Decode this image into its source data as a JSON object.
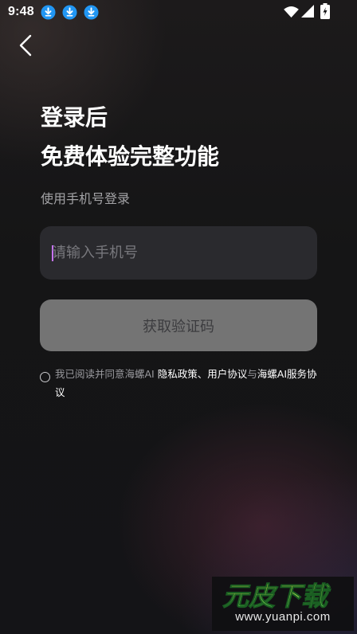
{
  "status_bar": {
    "time": "9:48",
    "notification_icons": [
      "download-icon",
      "download-icon",
      "download-icon"
    ],
    "right_icons": [
      "wifi-icon",
      "signal-icon",
      "battery-charging-icon"
    ]
  },
  "header": {
    "back_icon": "chevron-left-icon"
  },
  "title": {
    "line1": "登录后",
    "line2": "免费体验完整功能"
  },
  "subtitle": "使用手机号登录",
  "phone_field": {
    "value": "",
    "placeholder": "请输入手机号"
  },
  "get_code_button": {
    "label": "获取验证码",
    "state": "disabled"
  },
  "agreement": {
    "checked": false,
    "prefix": "我已阅读并同意海螺AI ",
    "privacy_link": "隐私政策",
    "separator": "、",
    "user_agreement_link": "用户协议",
    "conjunction": "与",
    "service_link": "海螺AI服务协议"
  },
  "watermark": {
    "logo": "元皮下载",
    "url": "www.yuanpi.com"
  },
  "colors": {
    "background": "#141416",
    "input_bg": "#2a2a2e",
    "button_disabled_bg": "#747474",
    "caret": "#c774ff",
    "download_badge": "#2196f3"
  }
}
